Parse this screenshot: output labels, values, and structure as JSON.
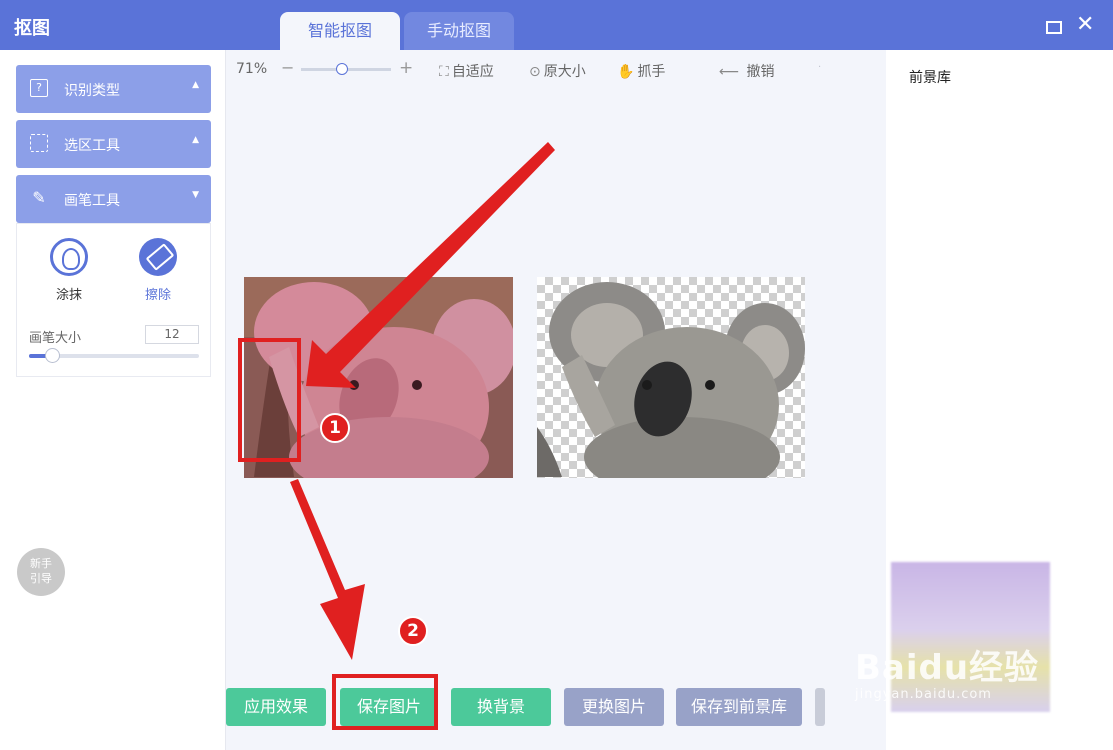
{
  "app": {
    "title": "抠图",
    "tabs": [
      {
        "label": "智能抠图",
        "active": true
      },
      {
        "label": "手动抠图",
        "active": false
      }
    ],
    "window_controls": {
      "maximize": "□",
      "close": "✕"
    }
  },
  "sidebar": {
    "sections": [
      {
        "label": "识别类型",
        "icon": "question-icon",
        "arrow": "▲"
      },
      {
        "label": "选区工具",
        "icon": "selection-icon",
        "arrow": "▲"
      },
      {
        "label": "画笔工具",
        "icon": "pencil-icon",
        "arrow": "▼"
      }
    ],
    "brush": {
      "tools": [
        {
          "label": "涂抹",
          "icon": "smear-icon",
          "selected": false
        },
        {
          "label": "擦除",
          "icon": "eraser-icon",
          "selected": true
        }
      ],
      "size_label": "画笔大小",
      "size_value": "12",
      "size_level": 0.14
    },
    "guide_label_1": "新手",
    "guide_label_2": "引导"
  },
  "toolbar": {
    "zoom": "71%",
    "zoom_level": 0.45,
    "zoom_minus": "−",
    "zoom_plus": "+",
    "fit": "自适应",
    "original": "原大小",
    "grab": "抓手",
    "undo": "撤销",
    "more": "·"
  },
  "actions": {
    "apply": "应用效果",
    "save_image": "保存图片",
    "change_bg": "换背景",
    "change_image": "更换图片",
    "save_to_fg": "保存到前景库"
  },
  "right_panel": {
    "title": "前景库"
  },
  "annotations": {
    "step1": "1",
    "step2": "2"
  },
  "watermark": {
    "main": "Baidu经验",
    "url": "jingyan.baidu.com"
  },
  "colors": {
    "accent": "#5a73d8",
    "green": "#4cc99a",
    "gray_button": "#98a2c8",
    "annotation_red": "#e02020"
  }
}
